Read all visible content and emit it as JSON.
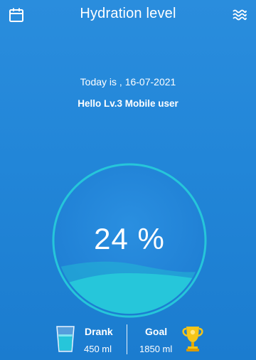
{
  "header": {
    "title": "Hydration level",
    "left_icon": "calendar-icon",
    "right_icon": "waves-icon"
  },
  "today": {
    "text": "Today is , 16-07-2021"
  },
  "greeting": "Hello Lv.3 Mobile user",
  "progress": {
    "percent_text": "24 %",
    "value": 0.24
  },
  "stats": {
    "drank_label": "Drank",
    "drank_value": "450 ml",
    "goal_label": "Goal",
    "goal_value": "1850 ml"
  },
  "colors": {
    "background": "#2286d8",
    "water": "#26c6da",
    "ring": "#26c6da",
    "trophy": "#f5c518"
  }
}
